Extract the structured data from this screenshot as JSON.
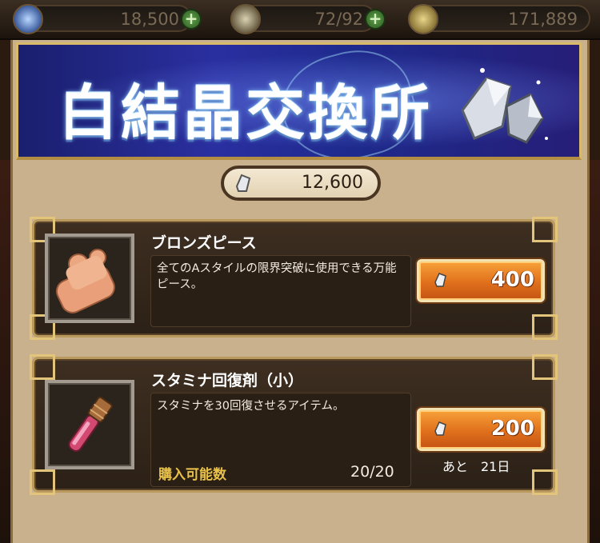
{
  "status_bar": {
    "gems": "18,500",
    "stamina": "72/92",
    "gold": "171,889",
    "plus_symbol": "+"
  },
  "banner": {
    "title": "白結晶交換所"
  },
  "currency": {
    "icon": "white-crystal-icon",
    "amount": "12,600"
  },
  "items": [
    {
      "name": "ブロンズピース",
      "description": "全てのAスタイルの限界突破に使用できる万能ピース。",
      "price": "400",
      "icon": "bronze-puzzle-piece-icon"
    },
    {
      "name": "スタミナ回復剤（小）",
      "description": "スタミナを30回復させるアイテム。",
      "price": "200",
      "icon": "stamina-vial-icon",
      "limit_label": "購入可能数",
      "limit_value": "20/20",
      "remaining": "あと　21日"
    }
  ],
  "colors": {
    "accent_orange": "#e0701c",
    "frame_gold": "#d9b96a",
    "limit_yellow": "#e8c24a"
  }
}
